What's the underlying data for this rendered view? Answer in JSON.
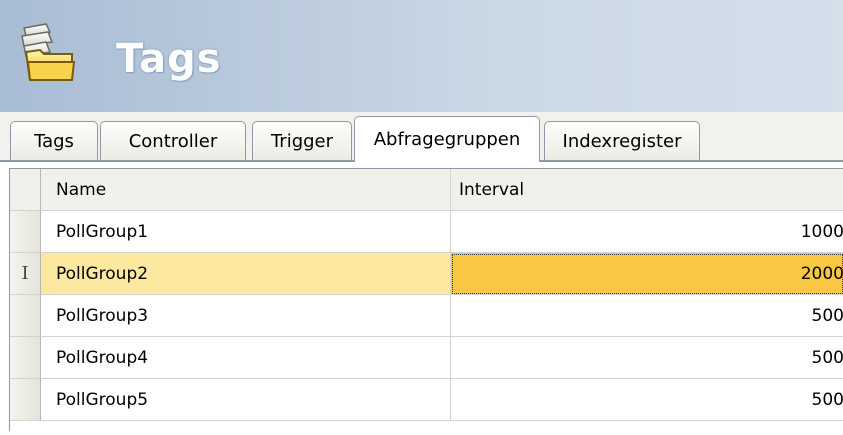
{
  "header": {
    "title": "Tags",
    "icon": "stacked-folders-icon"
  },
  "tabs": [
    {
      "label": "Tags",
      "active": false
    },
    {
      "label": "Controller",
      "active": false
    },
    {
      "label": "Trigger",
      "active": false
    },
    {
      "label": "Abfragegruppen",
      "active": true
    },
    {
      "label": "Indexregister",
      "active": false
    }
  ],
  "grid": {
    "columns": [
      "Name",
      "Interval"
    ],
    "rows": [
      {
        "name": "PollGroup1",
        "interval": "1000",
        "selected": false
      },
      {
        "name": "PollGroup2",
        "interval": "2000",
        "selected": true
      },
      {
        "name": "PollGroup3",
        "interval": "500",
        "selected": false
      },
      {
        "name": "PollGroup4",
        "interval": "500",
        "selected": false
      },
      {
        "name": "PollGroup5",
        "interval": "500",
        "selected": false
      }
    ],
    "current_row_marker": "I"
  },
  "colors": {
    "selected_row": "#fde8a0",
    "selected_cell": "#f9c741",
    "header_band": "#b9cadc"
  }
}
